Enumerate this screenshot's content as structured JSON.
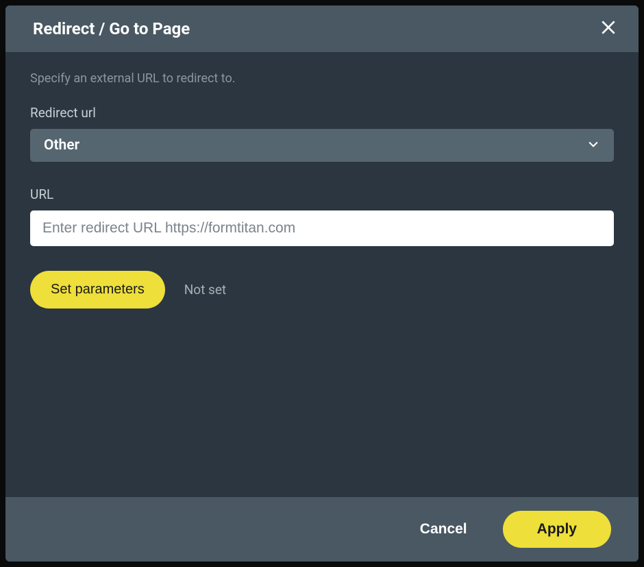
{
  "header": {
    "title": "Redirect / Go to Page"
  },
  "body": {
    "description": "Specify an external URL to redirect to.",
    "redirect_url": {
      "label": "Redirect url",
      "selected": "Other"
    },
    "url_field": {
      "label": "URL",
      "value": "",
      "placeholder": "Enter redirect URL https://formtitan.com"
    },
    "parameters": {
      "button_label": "Set parameters",
      "status": "Not set"
    }
  },
  "footer": {
    "cancel_label": "Cancel",
    "apply_label": "Apply"
  }
}
